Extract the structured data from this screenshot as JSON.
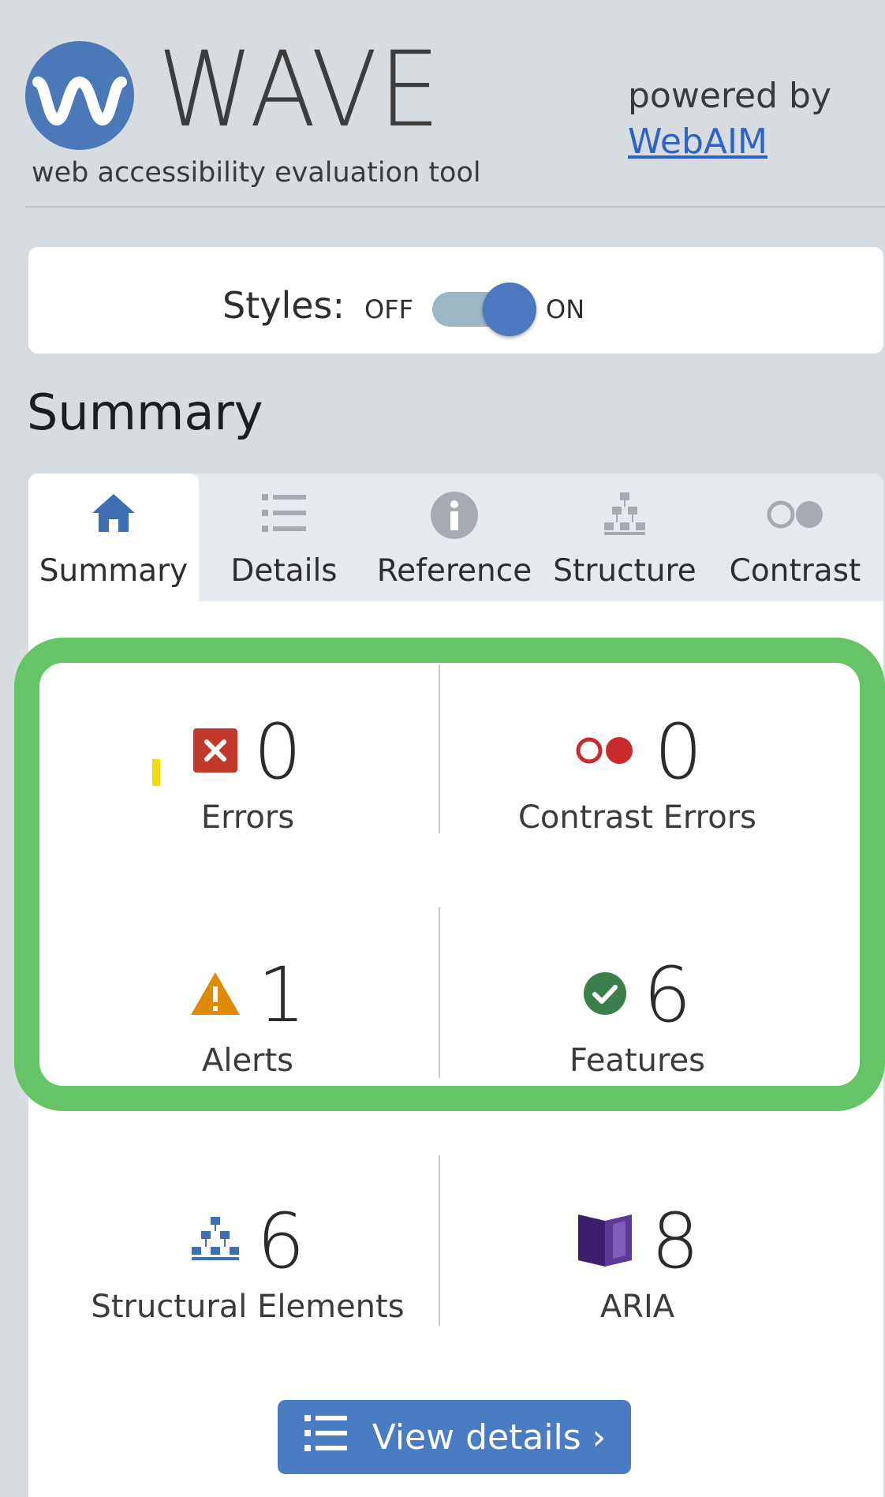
{
  "header": {
    "title": "WAVE",
    "tagline": "web accessibility evaluation tool",
    "powered_by": "powered by",
    "webaim_link": "WebAIM"
  },
  "styles_toggle": {
    "label": "Styles:",
    "off": "OFF",
    "on": "ON",
    "state": "on"
  },
  "summary_heading": "Summary",
  "tabs": [
    {
      "label": "Summary",
      "icon": "home-icon",
      "active": true
    },
    {
      "label": "Details",
      "icon": "list-icon",
      "active": false
    },
    {
      "label": "Reference",
      "icon": "info-icon",
      "active": false
    },
    {
      "label": "Structure",
      "icon": "structure-icon",
      "active": false
    },
    {
      "label": "Contrast",
      "icon": "contrast-icon",
      "active": false
    }
  ],
  "stats": {
    "errors": {
      "count": "0",
      "label": "Errors",
      "icon": "error-icon"
    },
    "contrast_errors": {
      "count": "0",
      "label": "Contrast Errors",
      "icon": "contrast-error-icon"
    },
    "alerts": {
      "count": "1",
      "label": "Alerts",
      "icon": "alert-icon"
    },
    "features": {
      "count": "6",
      "label": "Features",
      "icon": "feature-check-icon"
    },
    "structural": {
      "count": "6",
      "label": "Structural Elements",
      "icon": "structure-icon"
    },
    "aria": {
      "count": "8",
      "label": "ARIA",
      "icon": "aria-icon"
    }
  },
  "view_details": {
    "label": "View details ›",
    "icon": "list-icon"
  },
  "colors": {
    "brand_blue": "#4b78b8",
    "highlight_green": "#65c466",
    "error_red": "#c0392b",
    "alert_orange": "#e08a00",
    "feature_green": "#3b7f4a",
    "aria_purple": "#4b2a80"
  }
}
